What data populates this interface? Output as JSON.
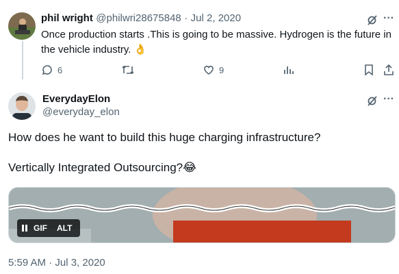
{
  "reply_tweet": {
    "author_name": "phil wright",
    "handle": "@philwri28675848",
    "separator": "·",
    "date": "Jul 2, 2020",
    "text": "Once production starts .This is going to be massive. Hydrogen is the future in the vehicle industry.",
    "emoji": "👌",
    "actions": {
      "replies": "6",
      "likes": "9"
    }
  },
  "main_tweet": {
    "author_name": "EverydayElon",
    "handle": "@everyday_elon",
    "line1": "How does he want to build this huge charging infrastructure?",
    "line2": "Vertically Integrated Outsourcing?",
    "emoji": "😂",
    "media": {
      "gif_label": "GIF",
      "alt_label": "ALT"
    },
    "timestamp": "5:59 AM · Jul 3, 2020"
  },
  "colors": {
    "text": "#0f1419",
    "muted": "#536471",
    "border": "#cfd9de"
  }
}
